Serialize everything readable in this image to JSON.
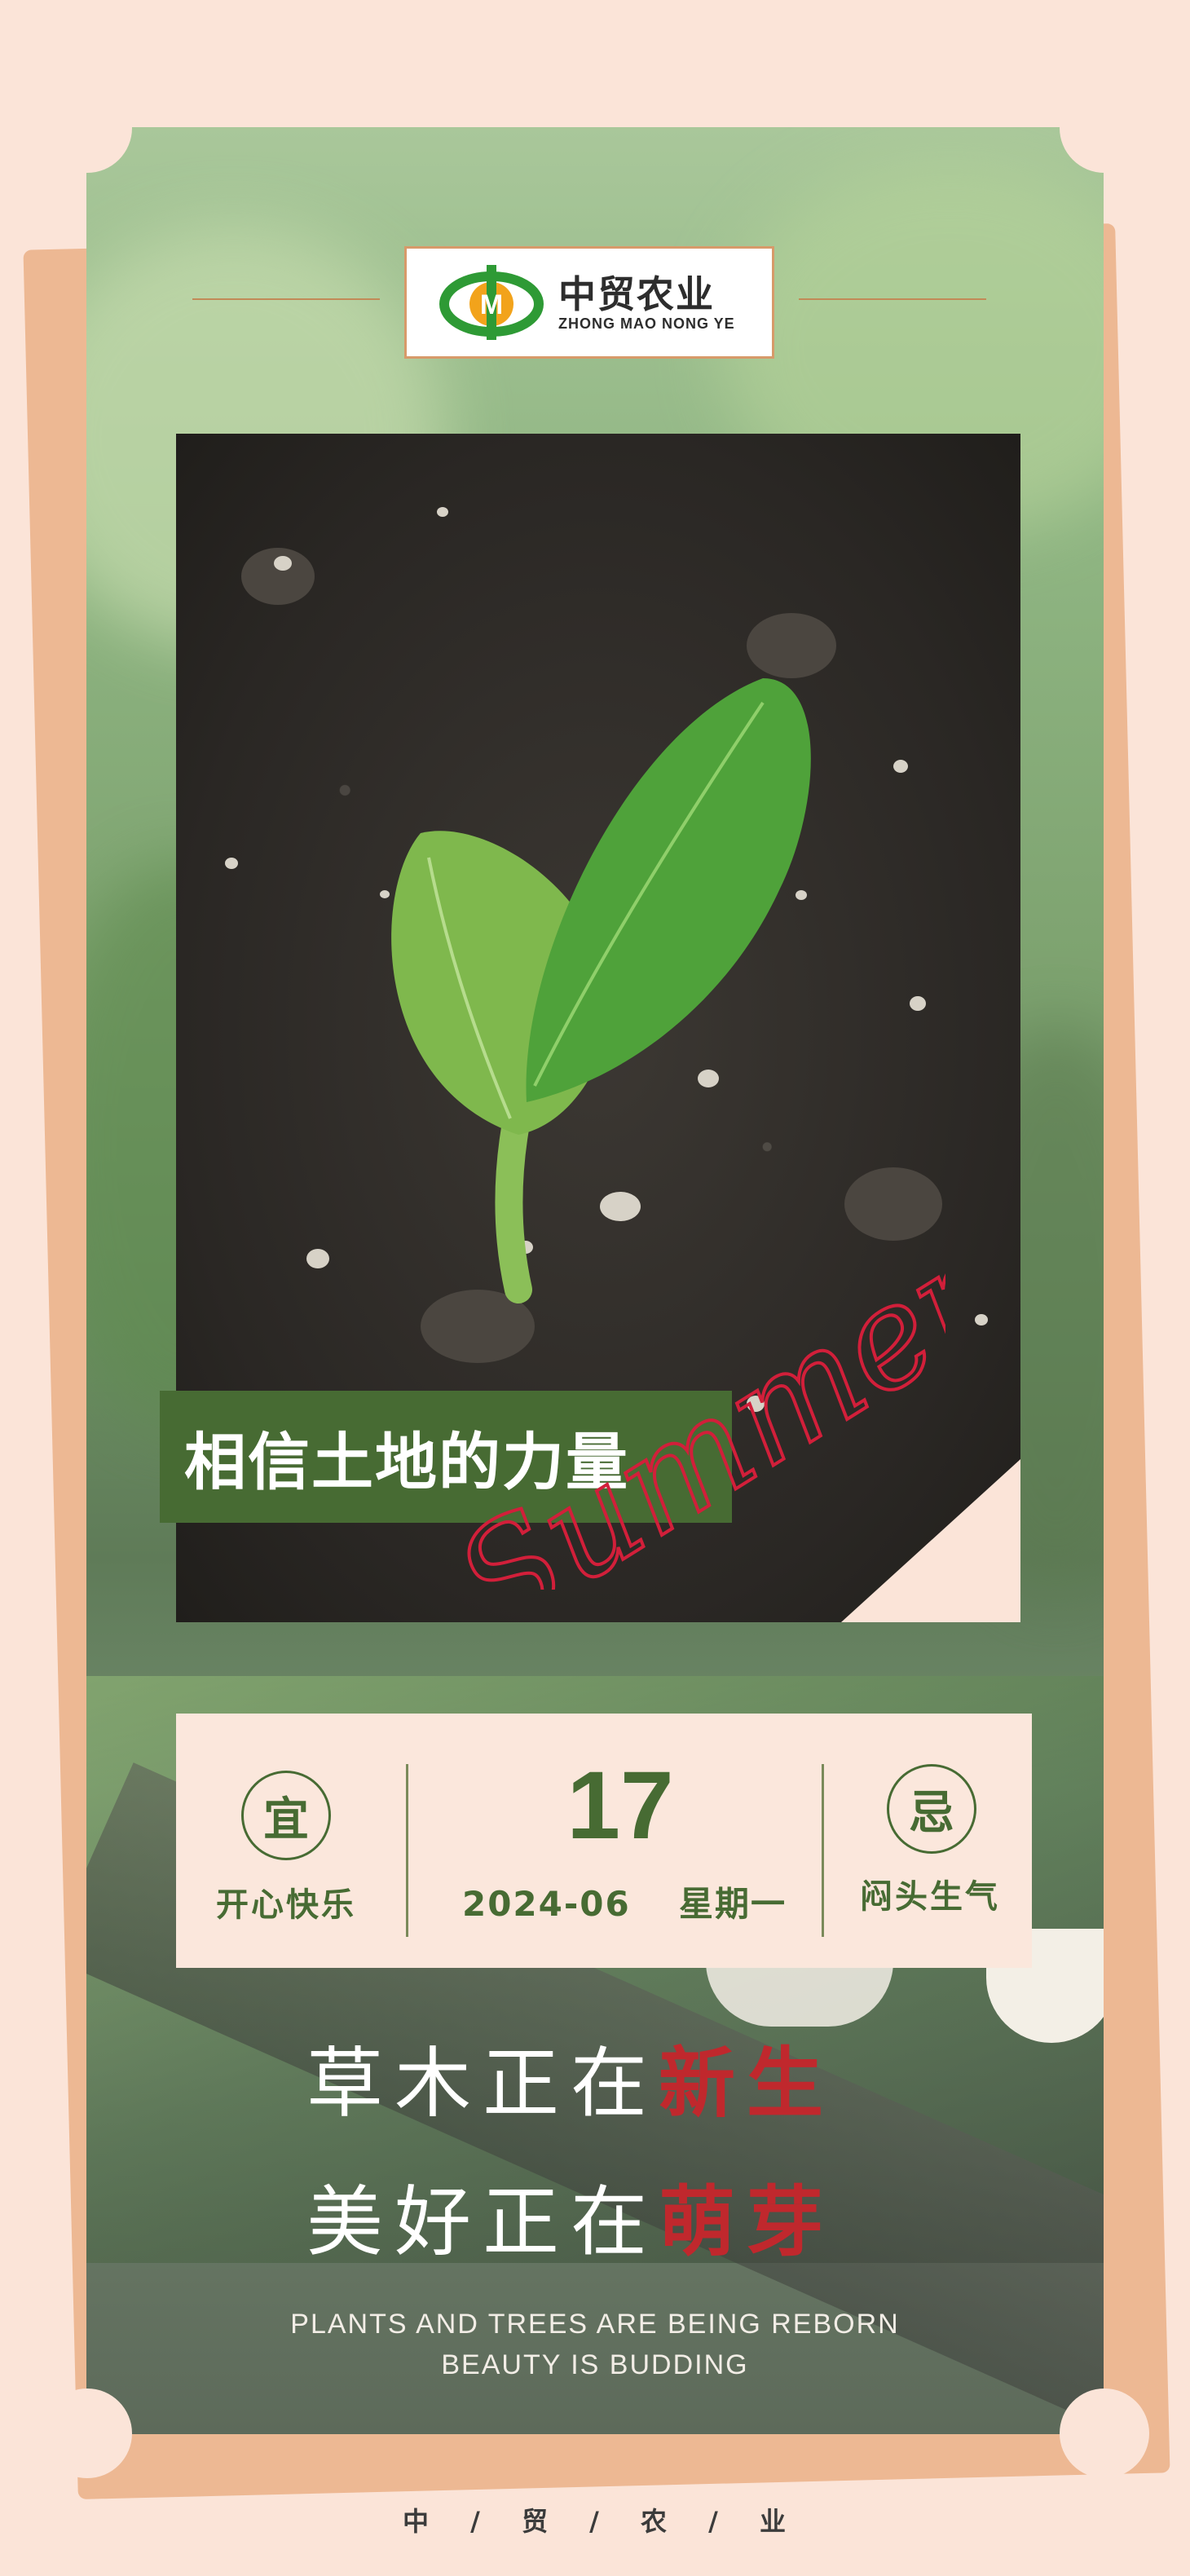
{
  "brand": {
    "name_cn": "中贸农业",
    "name_en": "ZHONG MAO NONG YE",
    "logo_letter": "M",
    "colors": {
      "green": "#2e9a35",
      "orange": "#f2a31b",
      "red": "#d2232a"
    }
  },
  "headline": "相信土地的力量",
  "script_word": "Summer",
  "calendar": {
    "good": {
      "symbol": "宜",
      "text": "开心快乐"
    },
    "day": "17",
    "date": "2024-06",
    "weekday": "星期一",
    "bad": {
      "symbol": "忌",
      "text": "闷头生气"
    }
  },
  "slogan": {
    "line1_white": "草木正在",
    "line1_red": "新生",
    "line2_white": "美好正在",
    "line2_red": "萌芽"
  },
  "english": {
    "line1": "PLANTS AND TREES ARE BEING REBORN",
    "line2": "BEAUTY IS BUDDING"
  },
  "footer": [
    "中",
    "/",
    "贸",
    "/",
    "农",
    "/",
    "业"
  ]
}
